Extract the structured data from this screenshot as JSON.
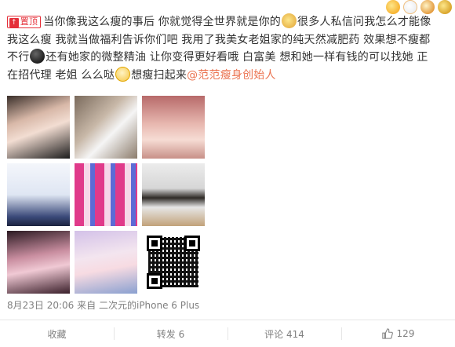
{
  "post": {
    "pin_badge": "置顶",
    "pin_mark": "↑",
    "text_part1": "当你像我这么瘦的事后 你就觉得全世界就是你的",
    "text_part2": "很多人私信问我怎么才能像我这么瘦 我就当做福利告诉你们吧 我用了我美女老姐家的纯天然减肥药 效果想不瘦都不行",
    "text_part3": "还有她家的微整精油 让你变得更好看哦 白富美 想和她一样有钱的可以找她 正在招代理 老姐 么么哒",
    "text_part4": "想瘦扫起来",
    "mention": "@范范瘦身创始人",
    "emoticons": [
      "doge-emoji",
      "black-ball-emoji",
      "smile-emoji"
    ]
  },
  "images": [
    {
      "name": "selfie-photo"
    },
    {
      "name": "hand-product-photo"
    },
    {
      "name": "pink-room-photo"
    },
    {
      "name": "app-screenshot-photo"
    },
    {
      "name": "product-boxes-photo"
    },
    {
      "name": "oil-bottles-photo"
    },
    {
      "name": "girl-selfie-photo"
    },
    {
      "name": "girl-holding-product-photo"
    },
    {
      "name": "qr-code"
    }
  ],
  "meta": {
    "date": "8月23日 20:06",
    "source_prefix": "来自",
    "source": "二次元的iPhone 6 Plus"
  },
  "actions": {
    "favorite": "收藏",
    "repost": "转发 6",
    "comment": "评论 414",
    "like": "129"
  },
  "colors": {
    "mention": "#eb7350",
    "pin": "#e5303a",
    "muted": "#808080"
  }
}
